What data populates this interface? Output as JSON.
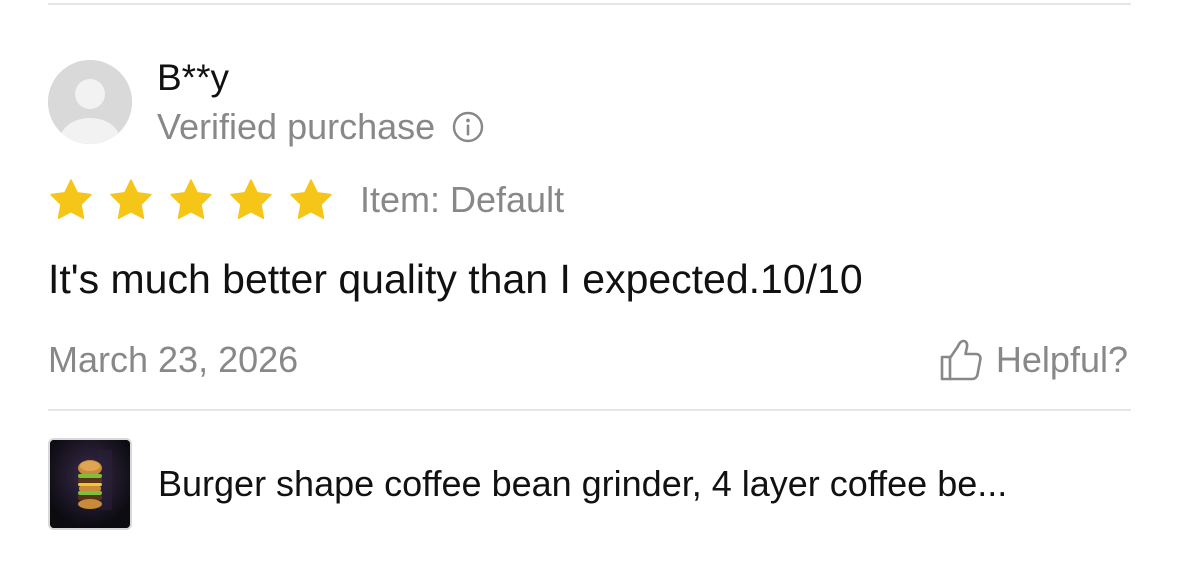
{
  "review": {
    "reviewer_name": "B**y",
    "verified_label": "Verified purchase",
    "rating": 5,
    "rating_max": 5,
    "variant_text": "Item: Default",
    "body": "It's much better quality than I expected.10/10",
    "date": "March 23, 2026",
    "helpful_label": "Helpful?"
  },
  "product": {
    "title": "Burger shape coffee bean grinder, 4 layer coffee be..."
  },
  "icons": {
    "avatar": "default-user-avatar",
    "info": "info-circle-icon",
    "star": "star-icon",
    "thumb": "thumbs-up-outline-icon"
  },
  "colors": {
    "star": "#F5C518",
    "secondary_text": "#888888",
    "primary_text": "#111111",
    "divider": "#E6E6E6",
    "avatar_bg": "#D9D9D9"
  }
}
